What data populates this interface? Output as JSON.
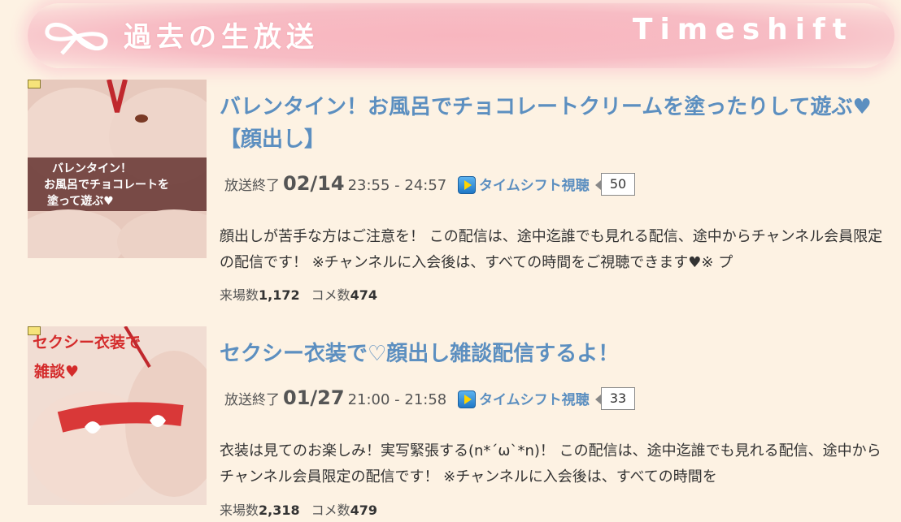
{
  "header": {
    "title": "過去の生放送",
    "subtitle": "Timeshift",
    "colors": {
      "banner": "#f7bcc4",
      "text": "#ffffff"
    }
  },
  "programs": [
    {
      "title": "バレンタイン！お風呂でチョコレートクリームを塗ったりして遊ぶ♥【顔出し】",
      "status": "放送終了",
      "date": "02/14",
      "time": "23:55 - 24:57",
      "timeshift_label": "タイムシフト視聴",
      "comment_count": "50",
      "description": "顔出しが苦手な方はご注意を！ この配信は、途中迄誰でも見れる配信、途中からチャンネル会員限定の配信です！ ※チャンネルに入会後は、すべての時間をご視聴できます♥※ プ",
      "visitors_label": "来場数",
      "visitors": "1,172",
      "comments_label": "コメ数",
      "comments": "474",
      "thumb_caption": [
        "バレンタイン！",
        "お風呂でチョコレートを",
        "塗って遊ぶ♥"
      ]
    },
    {
      "title": "セクシー衣装で♡顔出し雑談配信するよ！",
      "status": "放送終了",
      "date": "01/27",
      "time": "21:00 - 21:58",
      "timeshift_label": "タイムシフト視聴",
      "comment_count": "33",
      "description": "衣装は見てのお楽しみ！実写緊張する(n*´ω`*n)！ この配信は、途中迄誰でも見れる配信、途中からチャンネル会員限定の配信です！ ※チャンネルに入会後は、すべての時間を",
      "visitors_label": "来場数",
      "visitors": "2,318",
      "comments_label": "コメ数",
      "comments": "479",
      "thumb_caption": [
        "セクシー衣装で",
        "雑談♥"
      ]
    }
  ]
}
